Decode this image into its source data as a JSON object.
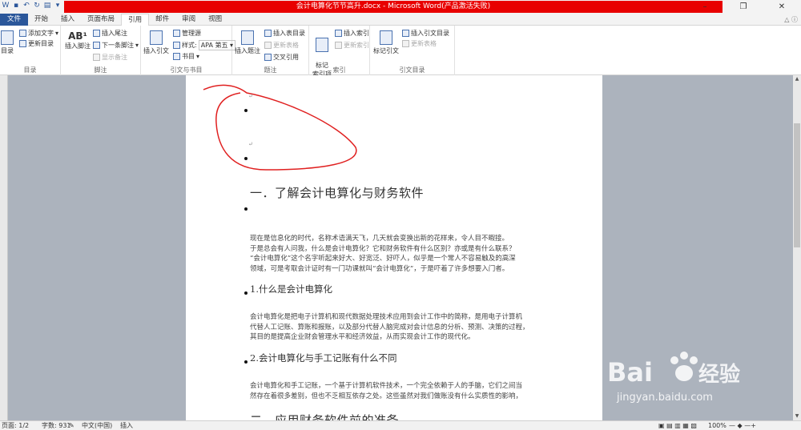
{
  "window": {
    "title": "会计电算化节节高升.docx - Microsoft Word(产品激活失败)",
    "controls": [
      "–",
      "❐",
      "✕"
    ]
  },
  "tabs": [
    {
      "label": "文件"
    },
    {
      "label": "开始"
    },
    {
      "label": "插入"
    },
    {
      "label": "页面布局"
    },
    {
      "label": "引用"
    },
    {
      "label": "邮件"
    },
    {
      "label": "审阅"
    },
    {
      "label": "视图"
    }
  ],
  "ribbon": {
    "toc": {
      "big": "目录",
      "add_text": "添加文字",
      "update": "更新目录",
      "label": "目录"
    },
    "footnote": {
      "insert_footnote": "插入脚注",
      "insert_endnote": "插入尾注",
      "next_footnote": "下一条脚注",
      "show_notes": "显示备注",
      "label": "脚注"
    },
    "citations": {
      "insert_citation": "插入引文",
      "manage_sources": "管理源",
      "style_label": "样式:",
      "style_value": "APA 第五",
      "bibliography": "书目",
      "label": "引文与书目"
    },
    "captions": {
      "insert_caption": "插入题注",
      "insert_table_of_figures": "插入表目录",
      "update_table": "更新表格",
      "cross_reference": "交叉引用",
      "label": "题注"
    },
    "index": {
      "mark_entry": "标记\n索引项",
      "insert_index": "插入索引",
      "update_index": "更新索引",
      "label": "索引"
    },
    "authorities": {
      "mark_citation": "标记引文",
      "insert_toa": "插入引文目录",
      "update_table": "更新表格",
      "label": "引文目录"
    }
  },
  "document": {
    "heading1": "一．了解会计电算化与财务软件",
    "para1": [
      "现在是信息化的时代，名称术语满天飞，几天就会变换出新的花样来，令人目不暇接。",
      "于是总会有人问我，什么是会计电算化？它和财务软件有什么区别？亦或是有什么联系？",
      "“会计电算化”这个名字听起来好大、好宽泛、好吓人，似乎是一个常人不容易触及的高深",
      "领域，可是考取会计证时有一门功课就叫“会计电算化”，于是吓着了许多想要入门者。"
    ],
    "heading2a": "1.什么是会计电算化",
    "para2": [
      "会计电算化是把电子计算机和现代数据处理技术应用到会计工作中的简称，是用电子计算机",
      "代替人工记账、算账和报账，以及部分代替人脑完成对会计信息的分析、预测、决策的过程，",
      "其目的是提高企业财会管理水平和经济效益，从而实现会计工作的现代化。"
    ],
    "heading2b": "2.会计电算化与手工记账有什么不同",
    "para3": [
      "会计电算化和手工记账，一个基于计算机软件技术，一个完全依赖于人的手脑，它们之间当",
      "然存在着很多差别，但也不乏相互依存之处。这些虽然对我们做账没有什么实质性的影响，"
    ],
    "heading1b": "二．应用财务软件前的准备"
  },
  "status": {
    "page": "页面: 1/2",
    "words": "字数: 931",
    "lang": "中文(中国)",
    "mode": "插入",
    "zoom": "100%"
  },
  "watermark": {
    "brand": "Bai",
    "brand2": "经验",
    "url": "jingyan.baidu.com"
  },
  "colors": {
    "accent": "#2b579a",
    "title_bar": "#e80000",
    "annotation": "#e02020"
  }
}
